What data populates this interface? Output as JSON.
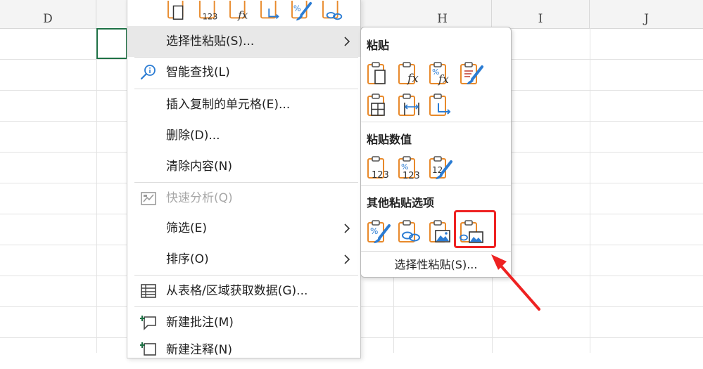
{
  "columns": [
    "D",
    "H",
    "I",
    "J"
  ],
  "context_menu": {
    "items": [
      {
        "label": "选择性粘贴(S)..."
      },
      {
        "label": "智能查找(L)"
      },
      {
        "label": "插入复制的单元格(E)..."
      },
      {
        "label": "删除(D)..."
      },
      {
        "label": "清除内容(N)"
      },
      {
        "label": "快速分析(Q)"
      },
      {
        "label": "筛选(E)"
      },
      {
        "label": "排序(O)"
      },
      {
        "label": "从表格/区域获取数据(G)..."
      },
      {
        "label": "新建批注(M)"
      },
      {
        "label": "新建注释(N)"
      }
    ]
  },
  "paste_submenu": {
    "paste_heading": "粘贴",
    "paste_values_heading": "粘贴数值",
    "other_heading": "其他粘贴选项",
    "footer_label": "选择性粘贴(S)..."
  },
  "icons": {
    "paste": "paste-icon",
    "formulas": "paste-formulas-icon",
    "formulas_number_format": "paste-formulas-number-format-icon",
    "keep_source_format": "paste-keep-source-formatting-icon",
    "no_borders": "paste-no-borders-icon",
    "keep_column_width": "paste-keep-column-widths-icon",
    "transpose": "paste-transpose-icon",
    "values": "paste-values-icon",
    "values_number_format": "paste-values-number-format-icon",
    "values_source_format": "paste-values-source-formatting-icon",
    "formatting": "paste-formatting-icon",
    "link": "paste-link-icon",
    "picture": "paste-picture-icon",
    "linked_picture": "paste-linked-picture-icon"
  },
  "colors": {
    "clipboard_orange": "#e8892a",
    "accent_blue": "#2b7cd3",
    "highlight_red": "#ee2222",
    "selection_green": "#1e7145"
  }
}
